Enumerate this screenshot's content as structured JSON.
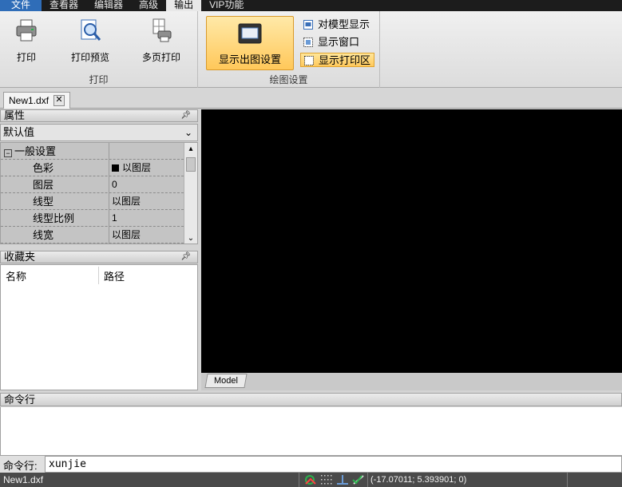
{
  "menubar": {
    "items": [
      {
        "label": "文件"
      },
      {
        "label": "查看器"
      },
      {
        "label": "编辑器"
      },
      {
        "label": "高级"
      },
      {
        "label": "输出"
      },
      {
        "label": "VIP功能"
      }
    ],
    "active_index": 4
  },
  "ribbon": {
    "print_group": {
      "label": "打印",
      "print_btn": "打印",
      "preview_btn": "打印预览",
      "multipage_btn": "多页打印"
    },
    "plot_group": {
      "label": "绘图设置",
      "display_btn": "显示出图设置",
      "model_display": "对模型显示",
      "show_window": "显示窗口",
      "show_print_area": "显示打印区"
    }
  },
  "document_tab": {
    "label": "New1.dxf",
    "close": "✕"
  },
  "properties": {
    "title": "属性",
    "combo_value": "默认值",
    "section": "一般设置",
    "rows": [
      {
        "name": "色彩",
        "value": "以图层"
      },
      {
        "name": "图层",
        "value": "0"
      },
      {
        "name": "线型",
        "value": "以图层"
      },
      {
        "name": "线型比例",
        "value": "1"
      },
      {
        "name": "线宽",
        "value": "以图层"
      }
    ]
  },
  "favorites": {
    "title": "收藏夹",
    "col_name": "名称",
    "col_path": "路径"
  },
  "canvas": {
    "model_tab": "Model",
    "background": "#000000"
  },
  "command": {
    "title": "命令行",
    "label": "命令行:",
    "value": "xunjie"
  },
  "statusbar": {
    "file": "New1.dxf",
    "coords": "(-17.07011; 5.393901; 0)"
  },
  "colors": {
    "accent": "#2f6db8",
    "selected": "#ffc95c",
    "menubar": "#1c1c1c"
  }
}
